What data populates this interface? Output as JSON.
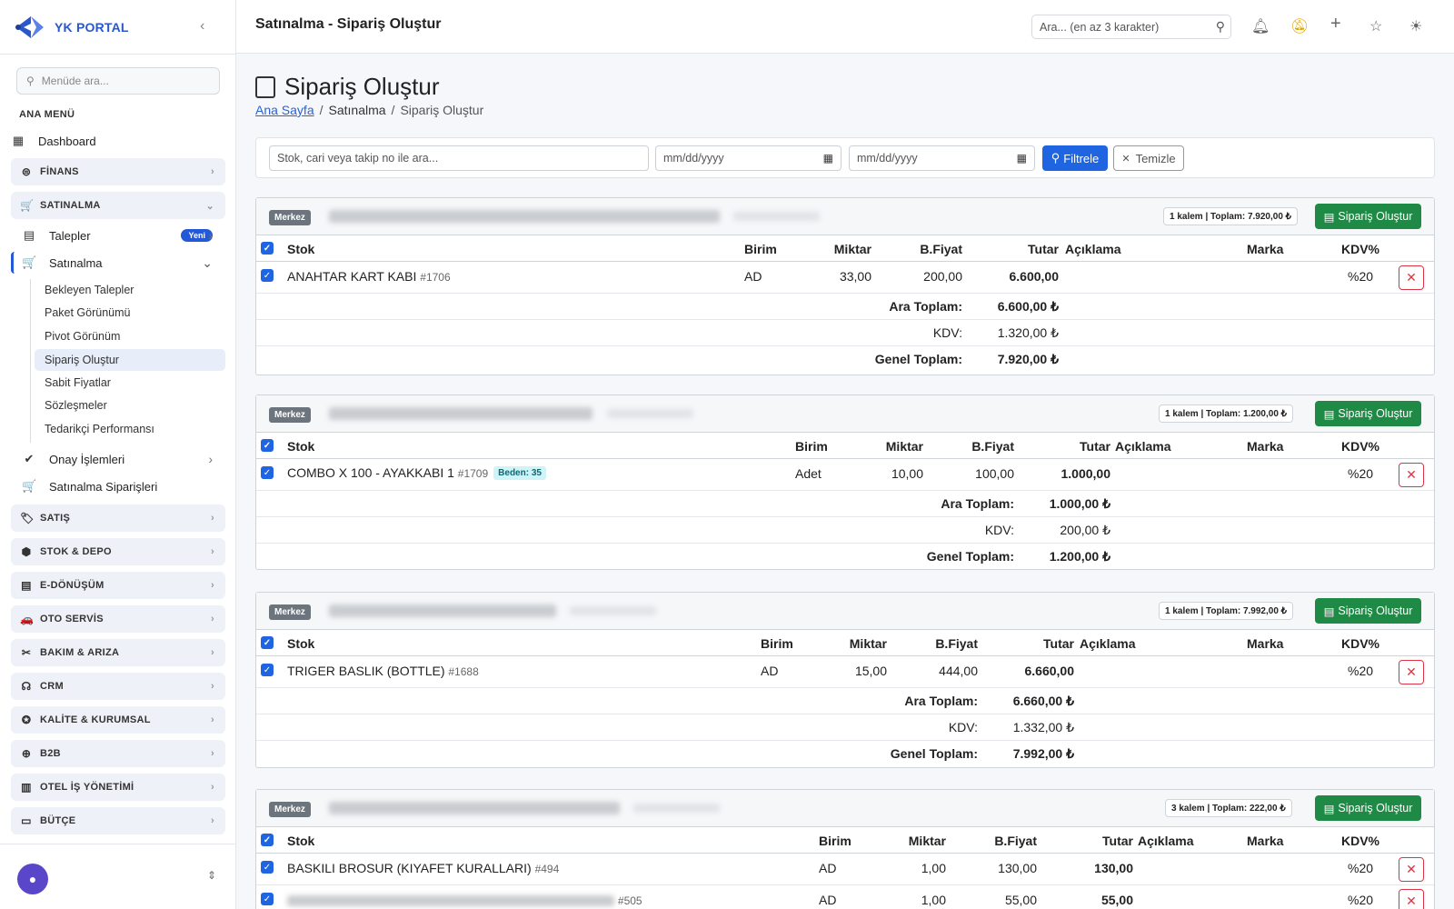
{
  "app": {
    "name": "YK PORTAL"
  },
  "topbar": {
    "title": "Satınalma - Sipariş Oluştur",
    "search_placeholder": "Ara... (en az 3 karakter)"
  },
  "sidebar": {
    "search_placeholder": "Menüde ara...",
    "section_title": "ANA MENÜ",
    "dashboard": "Dashboard",
    "groups": {
      "finans": "FİNANS",
      "satinalma": "SATINALMA",
      "satis": "SATIŞ",
      "stok": "STOK & DEPO",
      "edonusum": "E-DÖNÜŞÜM",
      "oto": "OTO SERVİS",
      "bakim": "BAKIM & ARIZA",
      "crm": "CRM",
      "kalite": "KALİTE & KURUMSAL",
      "b2b": "B2B",
      "otel": "OTEL İŞ YÖNETİMİ",
      "butce": "BÜTÇE"
    },
    "talepler": "Talepler",
    "talepler_badge": "Yeni",
    "satinalma": "Satınalma",
    "sub_items": [
      "Bekleyen Talepler",
      "Paket Görünümü",
      "Pivot Görünüm",
      "Sipariş Oluştur",
      "Sabit Fiyatlar",
      "Sözleşmeler",
      "Tedarikçi Performansı"
    ],
    "onay": "Onay İşlemleri",
    "siparisler": "Satınalma Siparişleri"
  },
  "page": {
    "title": "Sipariş Oluştur",
    "breadcrumb": [
      "Ana Sayfa",
      "Satınalma",
      "Sipariş Oluştur"
    ]
  },
  "filters": {
    "search_placeholder": "Stok, cari veya takip no ile ara...",
    "date1": "mm/dd/yyyy",
    "date2": "mm/dd/yyyy",
    "filter_label": "Filtrele",
    "clear_label": "Temizle"
  },
  "table_headers": {
    "stok": "Stok",
    "birim": "Birim",
    "miktar": "Miktar",
    "bfiyat": "B.Fiyat",
    "tutar": "Tutar",
    "aciklama": "Açıklama",
    "marka": "Marka",
    "kdv": "KDV%"
  },
  "totals_labels": {
    "ara": "Ara Toplam:",
    "kdv": "KDV:",
    "genel": "Genel Toplam:"
  },
  "orders": [
    {
      "branch": "Merkez",
      "summary": "1 kalem  |  Toplam: 7.920,00 ₺",
      "action": "Sipariş Oluştur",
      "items": [
        {
          "name": "ANAHTAR KART KABI",
          "code": "#1706",
          "badge": "",
          "unit": "AD",
          "qty": "33,00",
          "price": "200,00",
          "total": "6.600,00",
          "kdv": "%20"
        }
      ],
      "ara": "6.600,00 ₺",
      "kdv": "1.320,00 ₺",
      "genel": "7.920,00 ₺"
    },
    {
      "branch": "Merkez",
      "summary": "1 kalem  |  Toplam: 1.200,00 ₺",
      "action": "Sipariş Oluştur",
      "items": [
        {
          "name": "COMBO X 100 - AYAKKABI 1",
          "code": "#1709",
          "badge": "Beden: 35",
          "unit": "Adet",
          "qty": "10,00",
          "price": "100,00",
          "total": "1.000,00",
          "kdv": "%20"
        }
      ],
      "ara": "1.000,00 ₺",
      "kdv": "200,00 ₺",
      "genel": "1.200,00 ₺"
    },
    {
      "branch": "Merkez",
      "summary": "1 kalem  |  Toplam: 7.992,00 ₺",
      "action": "Sipariş Oluştur",
      "items": [
        {
          "name": "TRIGER BASLIK (BOTTLE)",
          "code": "#1688",
          "badge": "",
          "unit": "AD",
          "qty": "15,00",
          "price": "444,00",
          "total": "6.660,00",
          "kdv": "%20"
        }
      ],
      "ara": "6.660,00 ₺",
      "kdv": "1.332,00 ₺",
      "genel": "7.992,00 ₺"
    },
    {
      "branch": "Merkez",
      "summary": "3 kalem  |  Toplam: 222,00 ₺",
      "action": "Sipariş Oluştur",
      "items": [
        {
          "name": "BASKILI BROSUR (KIYAFET KURALLARI)",
          "code": "#494",
          "badge": "",
          "unit": "AD",
          "qty": "1,00",
          "price": "130,00",
          "total": "130,00",
          "kdv": "%20"
        },
        {
          "name": "",
          "code": "#505",
          "badge": "",
          "unit": "AD",
          "qty": "1,00",
          "price": "55,00",
          "total": "55,00",
          "kdv": "%20"
        }
      ]
    }
  ],
  "colors": {
    "primary": "#1f64e0",
    "success": "#1f8a45",
    "danger": "#dc3545",
    "brand": "#2a57c9"
  }
}
